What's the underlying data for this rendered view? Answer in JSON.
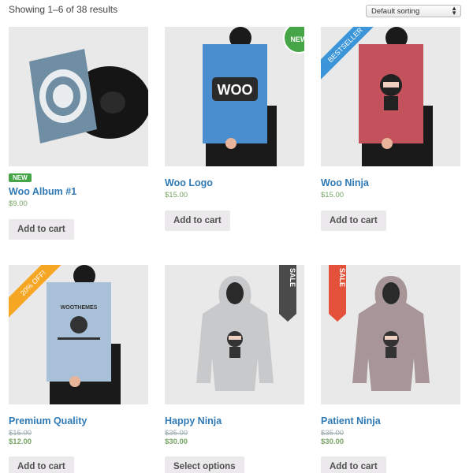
{
  "toolbar": {
    "result_count": "Showing 1–6 of 38 results",
    "sort_selected": "Default sorting"
  },
  "products": [
    {
      "title": "Woo Album #1",
      "price": "$9.00",
      "label": "NEW",
      "button": "Add to cart"
    },
    {
      "title": "Woo Logo",
      "price": "$15.00",
      "badge": "NEW",
      "button": "Add to cart",
      "poster_text": "WOO"
    },
    {
      "title": "Woo Ninja",
      "price": "$15.00",
      "ribbon": "BESTSELLER",
      "button": "Add to cart"
    },
    {
      "title": "Premium Quality",
      "old_price": "$15.00",
      "price": "$12.00",
      "ribbon": "20% OFF!",
      "button": "Add to cart",
      "poster_text": "WOOTHEMES"
    },
    {
      "title": "Happy Ninja",
      "old_price": "$35.00",
      "price": "$30.00",
      "ribbon": "SALE",
      "button": "Select options"
    },
    {
      "title": "Patient Ninja",
      "old_price": "$35.00",
      "price": "$30.00",
      "ribbon": "SALE",
      "button": "Add to cart"
    }
  ],
  "colors": {
    "link": "#2f79b5",
    "price": "#77a464",
    "new": "#46a546",
    "bestseller": "#3b95d8",
    "off": "#f5a623",
    "sale_dark": "#4a4a4a",
    "sale_red": "#e4513b"
  }
}
